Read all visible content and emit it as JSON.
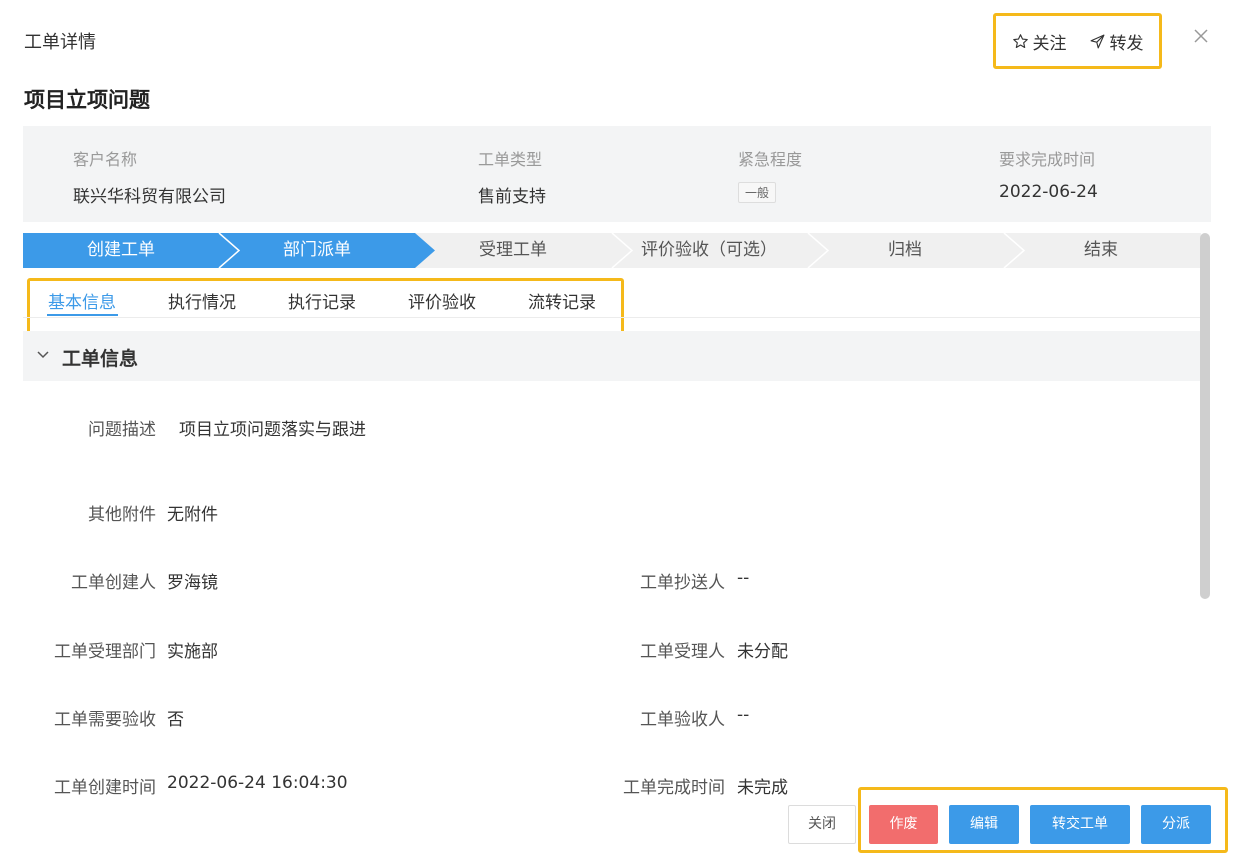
{
  "header": {
    "title": "工单详情",
    "follow_label": "关注",
    "forward_label": "转发"
  },
  "page_title": "项目立项问题",
  "summary": {
    "customer_label": "客户名称",
    "customer_value": "联兴华科贸有限公司",
    "type_label": "工单类型",
    "type_value": "售前支持",
    "urgency_label": "紧急程度",
    "urgency_value": "一般",
    "due_label": "要求完成时间",
    "due_value": "2022-06-24"
  },
  "steps": [
    {
      "label": "创建工单",
      "state": "done"
    },
    {
      "label": "部门派单",
      "state": "current"
    },
    {
      "label": "受理工单",
      "state": "todo"
    },
    {
      "label": "评价验收（可选）",
      "state": "todo"
    },
    {
      "label": "归档",
      "state": "todo"
    },
    {
      "label": "结束",
      "state": "todo"
    }
  ],
  "tabs": [
    {
      "label": "基本信息",
      "active": true
    },
    {
      "label": "执行情况",
      "active": false
    },
    {
      "label": "执行记录",
      "active": false
    },
    {
      "label": "评价验收",
      "active": false
    },
    {
      "label": "流转记录",
      "active": false
    }
  ],
  "section": {
    "title": "工单信息"
  },
  "fields": {
    "description_label": "问题描述",
    "description_value": "项目立项问题落实与跟进",
    "attachments_label": "其他附件",
    "attachments_value": "无附件",
    "creator_label": "工单创建人",
    "creator_value": "罗海镜",
    "cc_label": "工单抄送人",
    "cc_value": "--",
    "dept_label": "工单受理部门",
    "dept_value": "实施部",
    "assignee_label": "工单受理人",
    "assignee_value": "未分配",
    "need_accept_label": "工单需要验收",
    "need_accept_value": "否",
    "acceptor_label": "工单验收人",
    "acceptor_value": "--",
    "created_time_label": "工单创建时间",
    "created_time_value": "2022-06-24 16:04:30",
    "finish_time_label": "工单完成时间",
    "finish_time_value": "未完成"
  },
  "footer": {
    "close_label": "关闭",
    "void_label": "作废",
    "edit_label": "编辑",
    "transfer_label": "转交工单",
    "dispatch_label": "分派"
  },
  "colors": {
    "primary": "#3c9ae8",
    "danger": "#f26d6d",
    "highlight": "#f5b91a"
  }
}
